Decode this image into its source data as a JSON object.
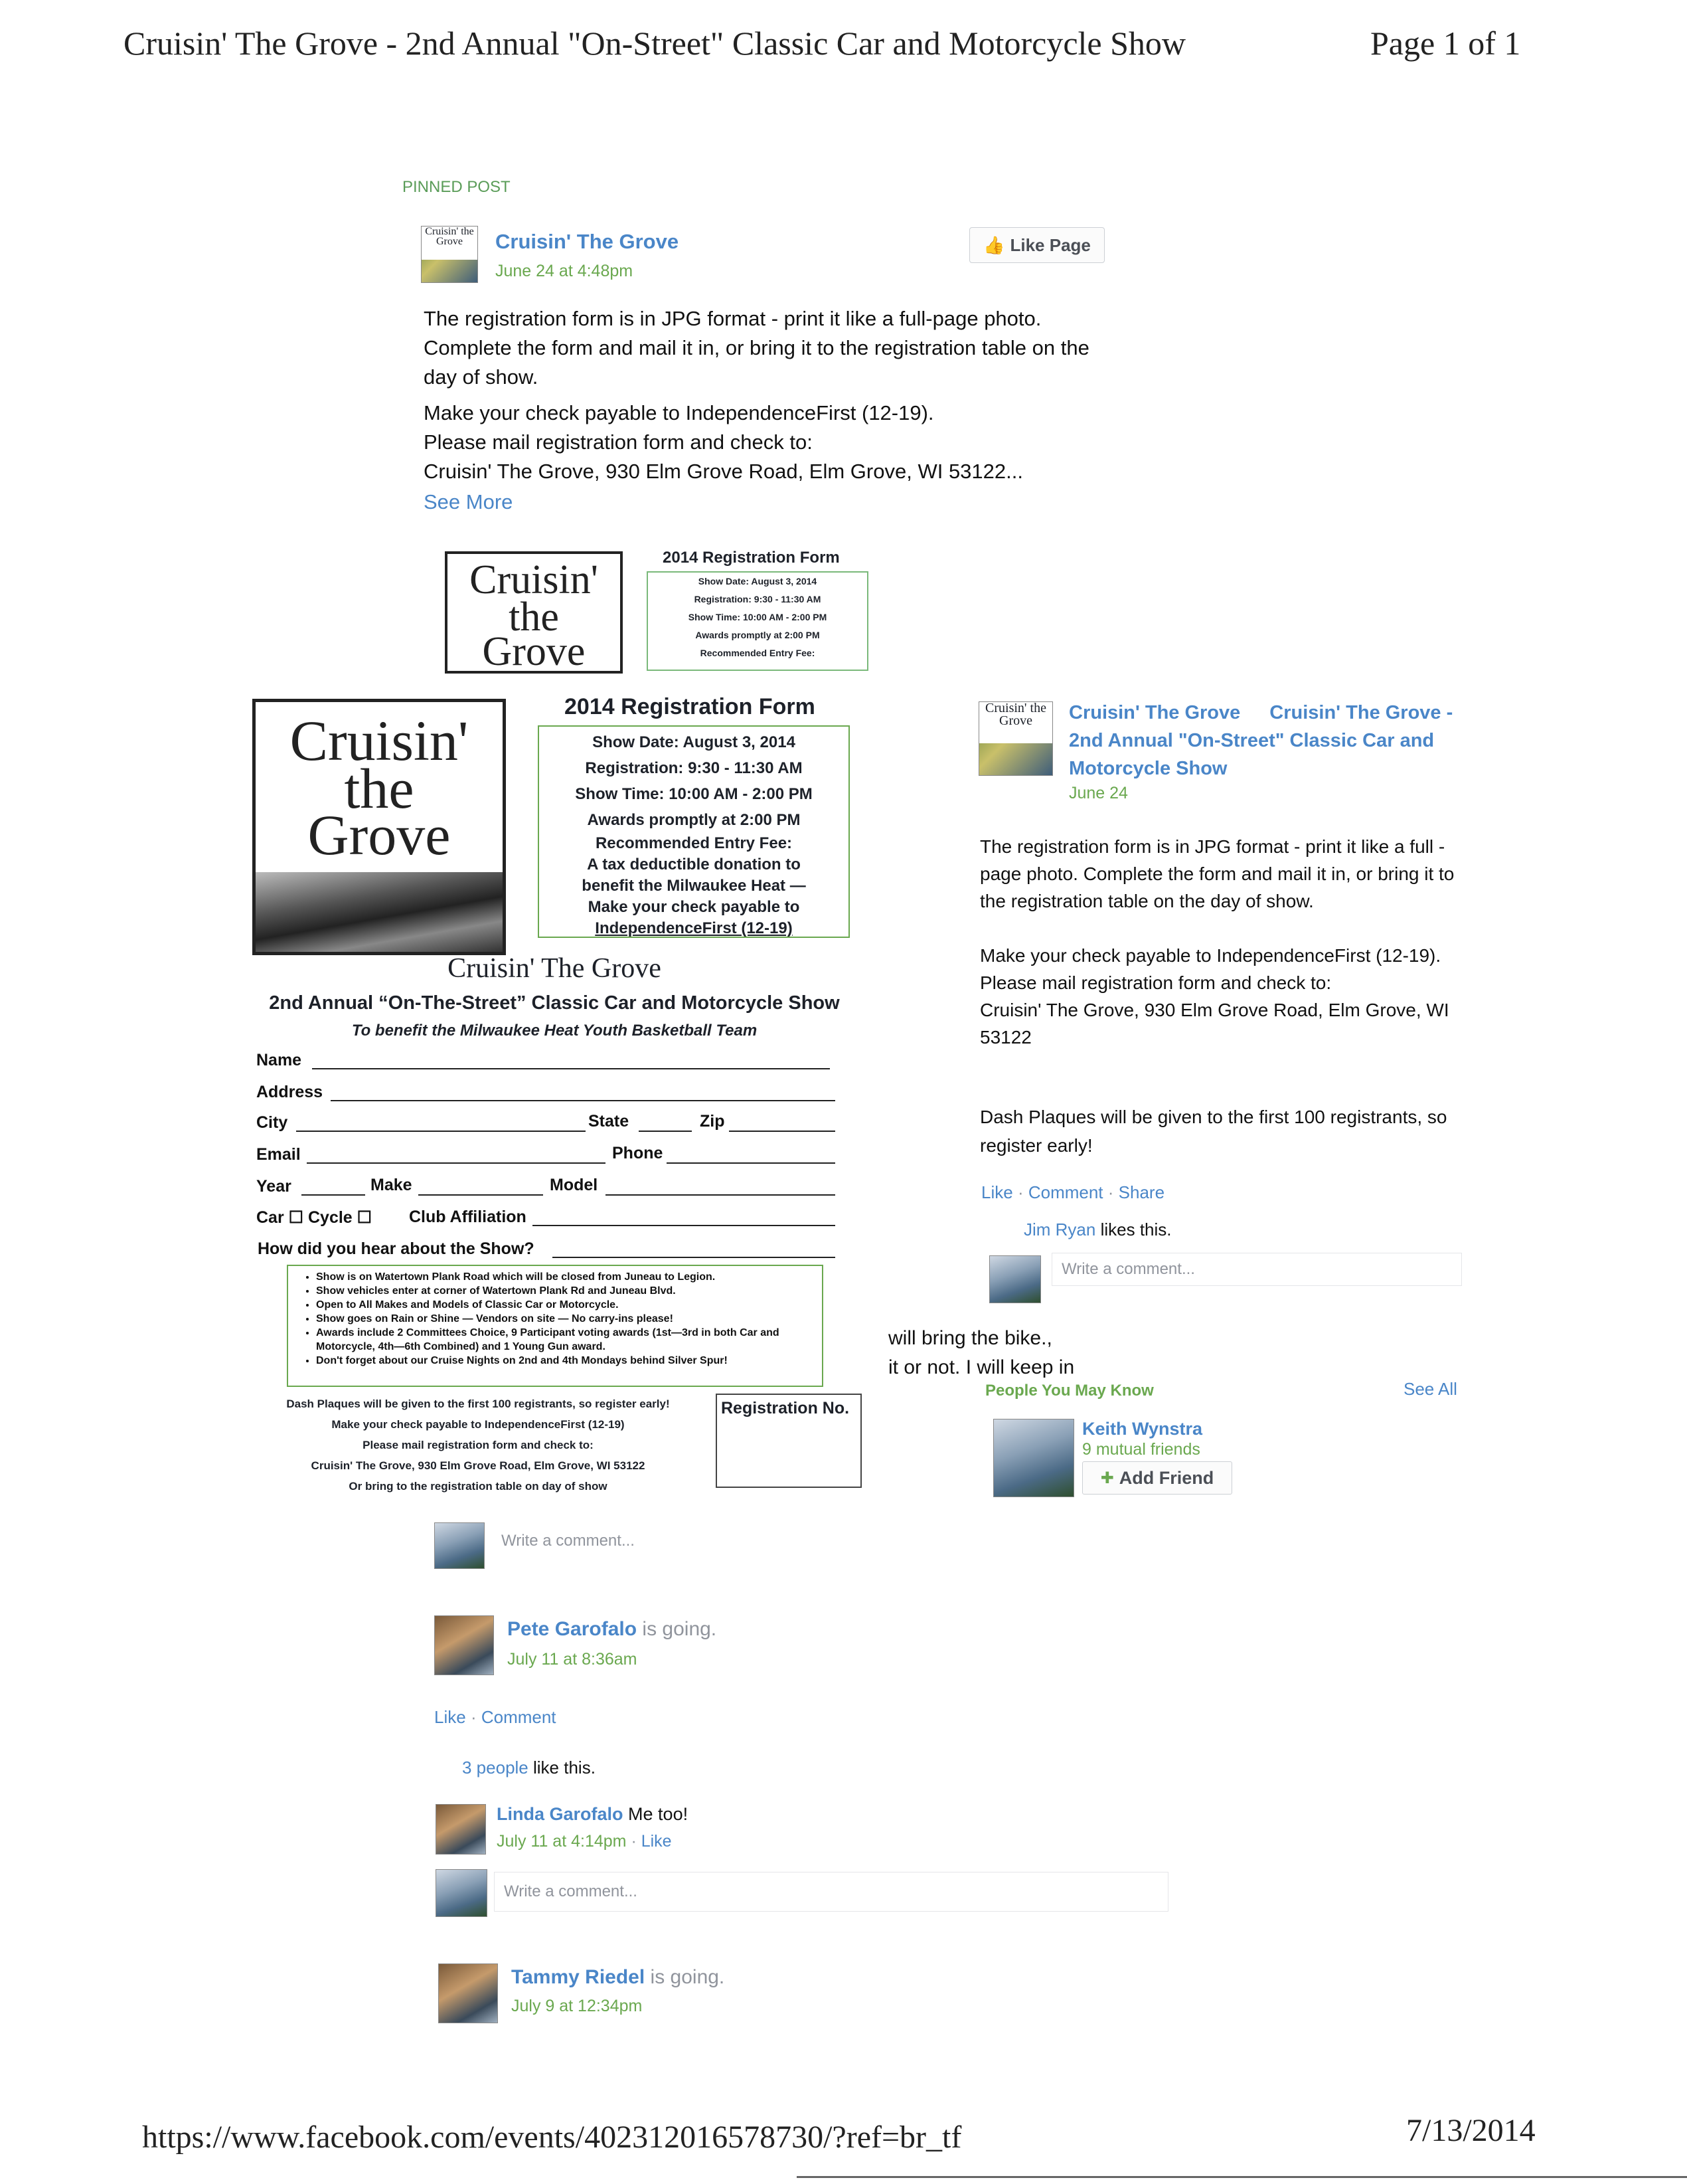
{
  "header": {
    "title": "Cruisin' The Grove - 2nd Annual \"On-Street\" Classic Car and Motorcycle Show",
    "page": "Page 1 of 1"
  },
  "footer": {
    "url": "https://www.facebook.com/events/402312016578730/?ref=br_tf",
    "date": "7/13/2014"
  },
  "pinned": {
    "label": "PINNED POST",
    "page_name": "Cruisin' The Grove",
    "timestamp": "June 24 at 4:48pm",
    "like_page": "Like Page",
    "para1": "The registration form is in JPG format - print it like a full-page photo. Complete the form and mail it in, or bring it to the registration table on the day of show.",
    "line1": "Make your check payable to IndependenceFirst (12-19).",
    "line2": "Please mail registration form and check to:",
    "line3": "Cruisin' The Grove, 930 Elm Grove Road, Elm Grove, WI 53122...",
    "see_more": "See More"
  },
  "logo": {
    "w1": "Cruisin'",
    "w2": "the",
    "w3": "Grove",
    "small": "Cruisin' the Grove"
  },
  "form_small": {
    "title": "2014 Registration Form",
    "lines": [
      "Show Date: August 3, 2014",
      "Registration: 9:30 - 11:30 AM",
      "Show Time: 10:00 AM - 2:00 PM",
      "Awards promptly at 2:00 PM",
      "Recommended Entry Fee:"
    ]
  },
  "form": {
    "title": "2014 Registration Form",
    "show_date": "Show Date: August 3, 2014",
    "registration": "Registration: 9:30 - 11:30 AM",
    "show_time": "Show Time: 10:00 AM - 2:00 PM",
    "awards": "Awards promptly at 2:00 PM",
    "fee_label": "Recommended Entry Fee:",
    "fee1": "A tax deductible donation to",
    "fee2": "benefit the Milwaukee Heat —",
    "fee3": "Make your check payable to",
    "fee4": "IndependenceFirst (12-19)",
    "heading": "Cruisin' The Grove",
    "subheading": "2nd Annual “On-The-Street” Classic Car and Motorcycle Show",
    "benefit": "To benefit the Milwaukee Heat Youth Basketball Team",
    "f_name": "Name",
    "f_address": "Address",
    "f_city": "City",
    "f_state": "State",
    "f_zip": "Zip",
    "f_email": "Email",
    "f_phone": "Phone",
    "f_year": "Year",
    "f_make": "Make",
    "f_model": "Model",
    "f_car": "Car ☐ Cycle ☐",
    "f_club": "Club Affiliation",
    "f_hear": "How did you hear about the Show?",
    "bullets": [
      "Show is on Watertown Plank Road which will be closed from Juneau to Legion.",
      "Show vehicles enter at corner of Watertown Plank Rd and Juneau Blvd.",
      "Open to All Makes and Models of Classic Car or Motorcycle.",
      "Show goes on Rain or Shine — Vendors on site — No carry-ins please!",
      "Awards include 2 Committees Choice, 9 Participant voting awards (1st—3rd in both Car and Motorcycle, 4th—6th Combined) and 1 Young Gun award.",
      "Don't forget about our Cruise Nights on 2nd and 4th Mondays behind Silver Spur!"
    ],
    "footer1": "Dash Plaques will be given to the first 100 registrants, so register early!",
    "footer2": "Make your check payable to IndependenceFirst (12-19)",
    "footer3": "Please mail registration form and check to:",
    "footer4": "Cruisin' The Grove, 930 Elm Grove Road, Elm Grove, WI 53122",
    "footer5": "Or bring to the registration table on day of show",
    "reg_no": "Registration No."
  },
  "right_post": {
    "page_name": "Cruisin' The Grove",
    "event_title": "Cruisin' The Grove - 2nd Annual \"On-Street\" Classic Car and Motorcycle Show",
    "date": "June 24",
    "p1": "The registration form is in JPG format - print it like a full -page photo. Complete the form and mail it in, or bring it to the registration table on the day of show.",
    "p2a": "Make your check payable to IndependenceFirst (12-19).",
    "p2b": "Please mail registration form and check to:",
    "p2c": "Cruisin' The Grove, 930 Elm Grove Road, Elm Grove, WI 53122",
    "p3": "Dash Plaques will be given to the first 100 registrants, so register early!",
    "actions": {
      "like": "Like",
      "comment": "Comment",
      "share": "Share"
    },
    "liker": "Jim Ryan",
    "likes_this": "likes this.",
    "write_comment": "Write a comment..."
  },
  "stray_text": {
    "l1": "will bring the bike.,",
    "l2": "it or not. I will keep in"
  },
  "pymk": {
    "title": "People You May Know",
    "see_all": "See All",
    "name": "Keith Wynstra",
    "mutual": "9 mutual friends",
    "add": "Add Friend"
  },
  "comment_box_1": "Write a comment...",
  "pete": {
    "name": "Pete Garofalo",
    "status": "is going.",
    "time": "July 11 at 8:36am",
    "like": "Like",
    "comment": "Comment",
    "people": "3 people",
    "like_this": "like this."
  },
  "linda": {
    "name": "Linda Garofalo",
    "text": "Me too!",
    "time": "July 11 at 4:14pm",
    "like": "Like"
  },
  "comment_box_2": "Write a comment...",
  "tammy": {
    "name": "Tammy Riedel",
    "status": "is going.",
    "time": "July 9 at 12:34pm"
  }
}
